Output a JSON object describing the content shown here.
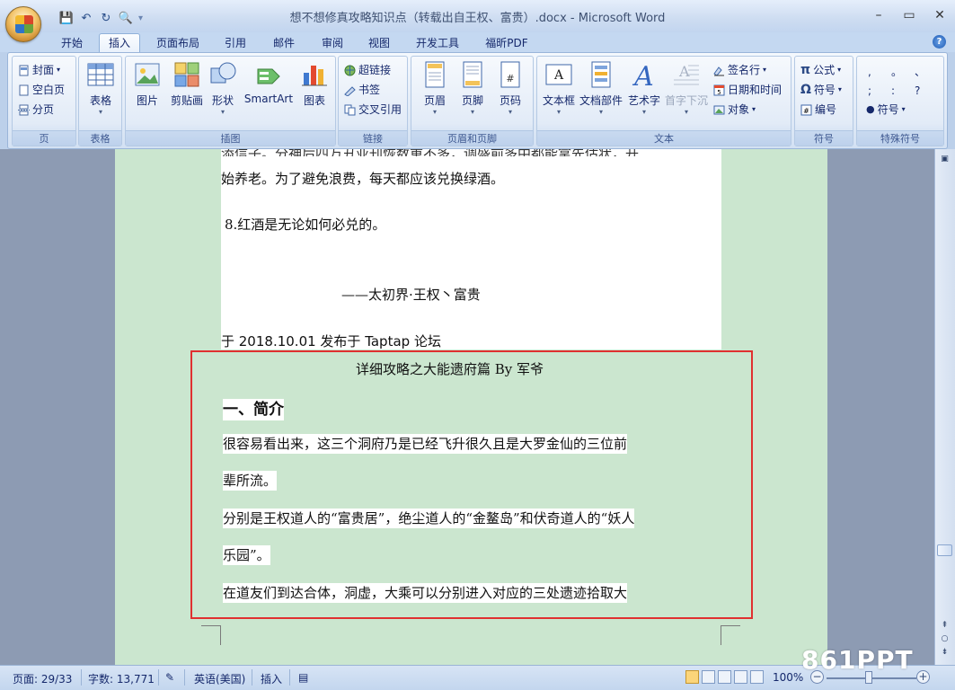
{
  "window": {
    "title": "想不想修真攻略知识点（转载出自王权、富贵）.docx - Microsoft Word",
    "minimize": "–",
    "maximize": "▭",
    "close": "✕"
  },
  "quick_access": {
    "save": "💾",
    "undo": "↶",
    "redo": "↻",
    "print_preview": "🔍",
    "customize": "▾"
  },
  "tabs": [
    "开始",
    "插入",
    "页面布局",
    "引用",
    "邮件",
    "审阅",
    "视图",
    "开发工具",
    "福昕PDF"
  ],
  "active_tab": "插入",
  "help": "?",
  "ribbon": {
    "page_group": {
      "label": "页",
      "items": [
        "封面",
        "空白页",
        "分页"
      ]
    },
    "table_group": {
      "label": "表格",
      "button": "表格"
    },
    "illustrations_group": {
      "label": "插图",
      "buttons": [
        "图片",
        "剪贴画",
        "形状",
        "SmartArt",
        "图表"
      ]
    },
    "links_group": {
      "label": "链接",
      "items": [
        "超链接",
        "书签",
        "交叉引用"
      ]
    },
    "header_footer_group": {
      "label": "页眉和页脚",
      "buttons": [
        "页眉",
        "页脚",
        "页码"
      ]
    },
    "text_group": {
      "label": "文本",
      "buttons": [
        "文本框",
        "文档部件",
        "艺术字",
        "首字下沉"
      ],
      "items": [
        "签名行",
        "日期和时间",
        "对象"
      ]
    },
    "symbols_group": {
      "label": "符号",
      "items": [
        "公式",
        "符号",
        "编号"
      ]
    },
    "special_group": {
      "label": "特殊符号",
      "chars": [
        ",",
        "。",
        "、",
        ";",
        ":",
        "?"
      ],
      "item": "符号"
    }
  },
  "document": {
    "line_top_cut": "添信子。分神后四万丑亚刊恢数重不多，调盛前多中都能拿先估状，开",
    "line_a": "始养老。为了避免浪费，每天都应该兑换绿酒。",
    "line_b": "8.红酒是无论如何必兑的。",
    "line_c": "——太初界·王权丶富贵",
    "line_d": "于 2018.10.01 发布于 Taptap 论坛",
    "title2": "详细攻略之大能遗府篇 By 军爷",
    "heading": "一、简介",
    "p1a": "很容易看出来，这三个洞府乃是已经飞升很久且是大罗金仙的三位前",
    "p1b": "辈所流。",
    "p2a": "分别是王权道人的“富贵居”，绝尘道人的“金鳌岛”和伏奇道人的“妖人",
    "p2b": "乐园”。",
    "p3": "在道友们到达合体，洞虚，大乘可以分别进入对应的三处遗迹拾取大"
  },
  "status": {
    "page": "页面: 29/33",
    "words": "字数: 13,771",
    "language": "英语(美国)",
    "mode": "插入",
    "zoom": "100%"
  },
  "watermark": "861PPT",
  "colors": {
    "page_bg": "#cbe6cf",
    "highlight_box": "#e03030",
    "ribbon_text": "#15286b"
  }
}
